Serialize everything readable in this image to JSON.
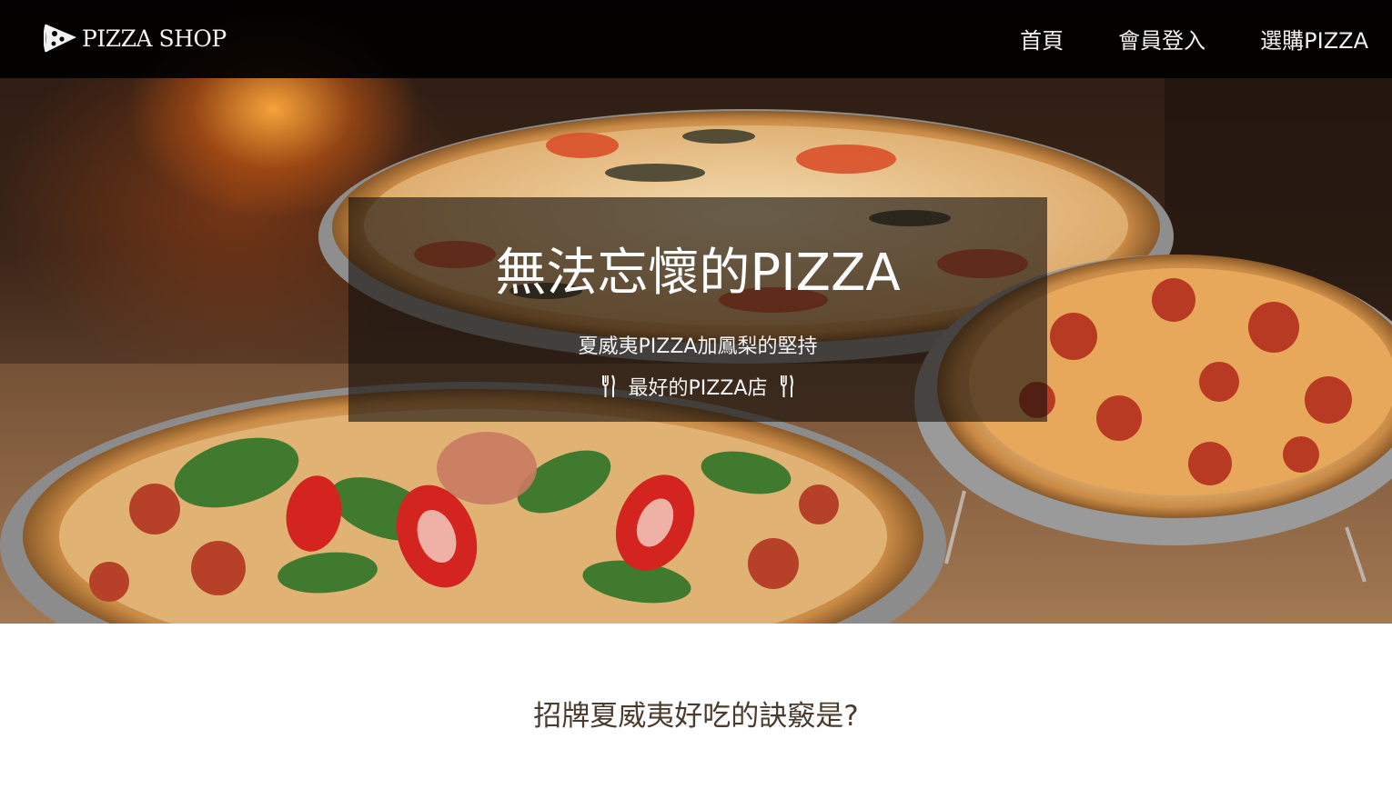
{
  "navbar": {
    "brand": "PIZZA SHOP",
    "brand_icon": "pizza-slice-icon",
    "links": [
      "首頁",
      "會員登入",
      "選購PIZZA"
    ]
  },
  "hero": {
    "title": "無法忘懷的PIZZA",
    "subtitle": "夏威夷PIZZA加鳳梨的堅持",
    "tagline": "最好的PIZZA店",
    "tagline_icon": "fork-knife-icon"
  },
  "section": {
    "heading": "招牌夏威夷好吃的訣竅是?"
  },
  "colors": {
    "navbar_bg": "#000000",
    "heading_text": "#4a3b2e"
  }
}
